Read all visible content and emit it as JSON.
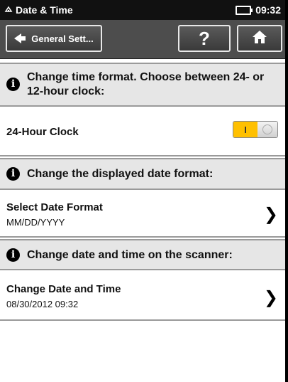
{
  "status_bar": {
    "title": "Date & Time",
    "time": "09:32",
    "app_icon": "scanner-icon",
    "battery_icon": "battery-icon"
  },
  "toolbar": {
    "back_label": "General Sett...",
    "help_label": "?",
    "home_icon": "home-icon"
  },
  "sections": {
    "time_format_info": "Change time format. Choose between 24- or 12-hour clock:",
    "hour_clock_label": "24-Hour Clock",
    "hour_clock_on_label": "I",
    "hour_clock_enabled": true,
    "date_format_info": "Change the displayed date format:",
    "select_date_format_title": "Select Date Format",
    "select_date_format_value": "MM/DD/YYYY",
    "datetime_info": "Change date and time on the scanner:",
    "change_datetime_title": "Change Date and Time",
    "change_datetime_value": "08/30/2012 09:32"
  },
  "colors": {
    "toggle_on": "#ffc000",
    "toolbar_bg": "#4d4d4d",
    "info_bg": "#e6e6e6"
  }
}
